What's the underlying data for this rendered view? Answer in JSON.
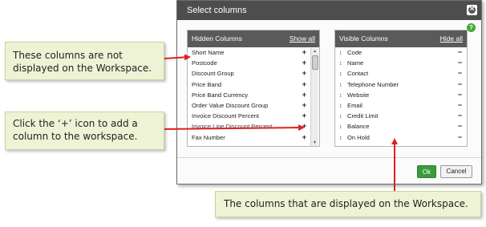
{
  "dialog": {
    "title": "Select columns",
    "help_icon": "?",
    "close_icon": "close-icon"
  },
  "hidden_panel": {
    "header": "Hidden Columns",
    "link": "Show all",
    "add_icon": "+",
    "items": [
      "Short Name",
      "Postcode",
      "Discount Group",
      "Price Band",
      "Price Band Currency",
      "Order Value Discount Group",
      "Invoice Discount Percent",
      "Invoice Line Discount Percent",
      "Fax Number"
    ]
  },
  "visible_panel": {
    "header": "Visible Columns",
    "link": "Hide all",
    "drag_icon": "↕",
    "remove_icon": "−",
    "items": [
      "Code",
      "Name",
      "Contact",
      "Telephone Number",
      "Website",
      "Email",
      "Credit Limit",
      "Balance",
      "On Hold"
    ]
  },
  "buttons": {
    "ok": "Ok",
    "cancel": "Cancel"
  },
  "callouts": {
    "c1_line1": "These columns are not",
    "c1_line2": "displayed on the Workspace.",
    "c2_line1": "Click the ‘+’ icon to add a",
    "c2_line2": "column to the workspace.",
    "c3": "The columns that are displayed on the Workspace."
  },
  "colors": {
    "title_bar": "#4d4d4d",
    "panel_header": "#5a5a5a",
    "ok_button": "#3a9b3a",
    "callout_bg": "#eef3d6",
    "arrow": "#e02020"
  }
}
